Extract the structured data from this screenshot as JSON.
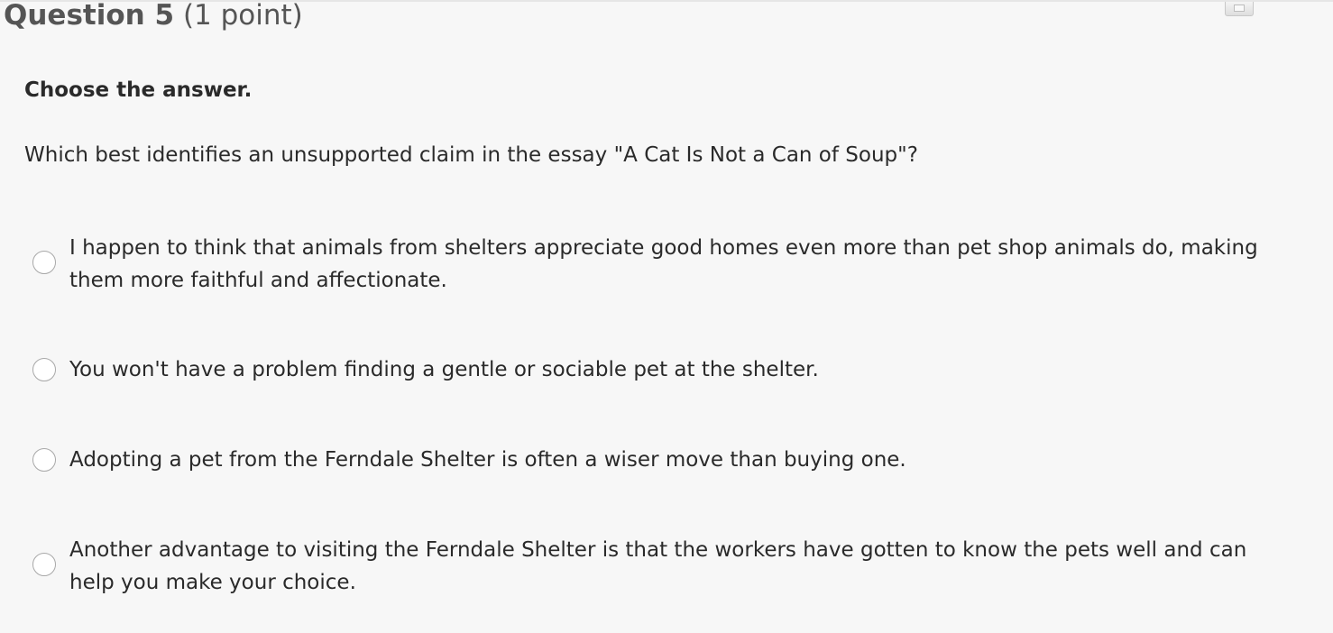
{
  "question": {
    "number_label": "Question 5",
    "points_label": "(1 point)"
  },
  "instruction": "Choose the answer.",
  "prompt": "Which best identifies an unsupported claim in the essay \"A Cat Is Not a Can of Soup\"?",
  "options": [
    {
      "label": "I happen to think that animals from shelters appreciate good homes even more than pet shop animals do, making them more faithful and affectionate.",
      "selected": false
    },
    {
      "label": "You won't have a problem finding a gentle or sociable pet at the shelter.",
      "selected": false
    },
    {
      "label": "Adopting a pet from the Ferndale Shelter is often a wiser move than buying one.",
      "selected": false
    },
    {
      "label": "Another advantage to visiting the Ferndale Shelter is that the workers have gotten to know the pets well and can help you make your choice.",
      "selected": false
    }
  ],
  "icons": {
    "print": "print-icon"
  },
  "colors": {
    "background": "#f7f7f7",
    "text": "#2a2a2a",
    "header_text": "#555555",
    "radio_border": "#a8a8a8"
  }
}
